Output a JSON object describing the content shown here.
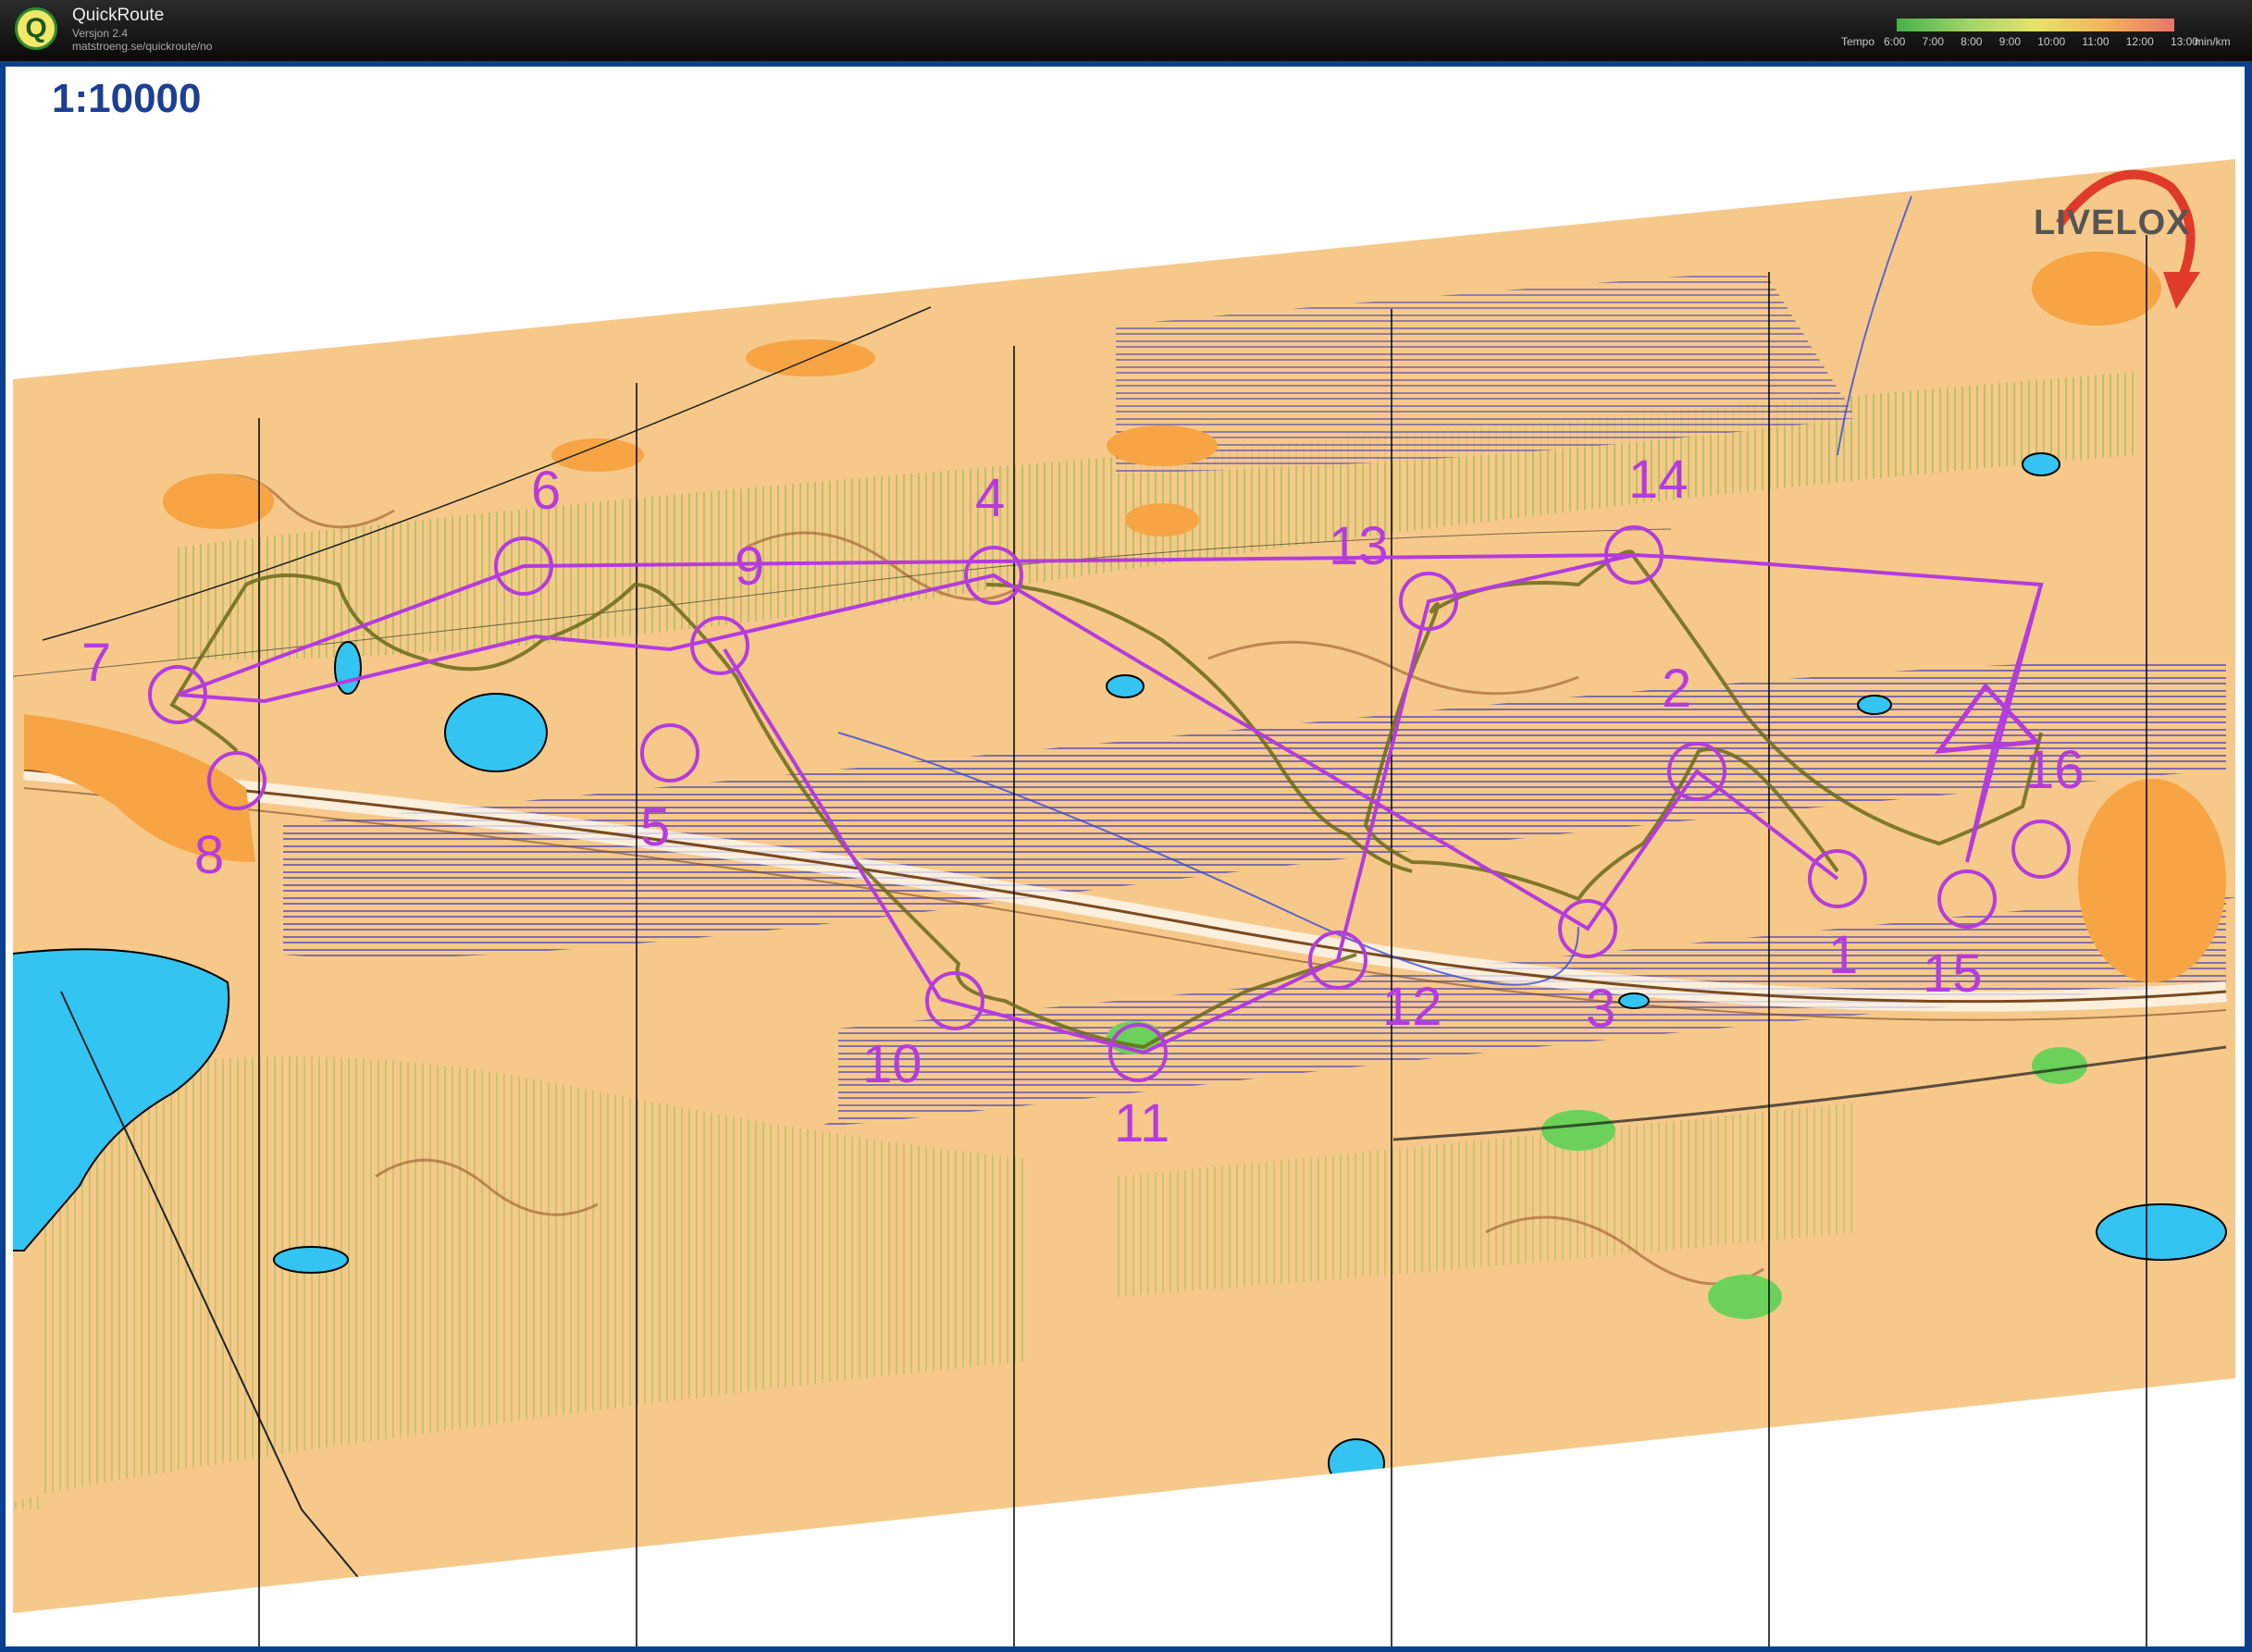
{
  "app": {
    "name": "QuickRoute",
    "version": "Versjon 2.4",
    "url": "matstroeng.se/quickroute/no"
  },
  "tempo": {
    "label": "Tempo",
    "ticks": [
      "6:00",
      "7:00",
      "8:00",
      "9:00",
      "10:00",
      "11:00",
      "12:00",
      "13:00"
    ],
    "unit": "min/km"
  },
  "map": {
    "scale": "1:10000",
    "watermark": "LIVELOX",
    "colors": {
      "terrain": "#f6c98a",
      "open": "#f6a444",
      "water": "#33c4f2",
      "course": "#b43cdc",
      "route": "#6b6a1a"
    }
  },
  "controls": [
    "6",
    "4",
    "9",
    "7",
    "5",
    "8",
    "13",
    "14",
    "2",
    "16",
    "1",
    "15",
    "3",
    "12",
    "10",
    "11"
  ]
}
